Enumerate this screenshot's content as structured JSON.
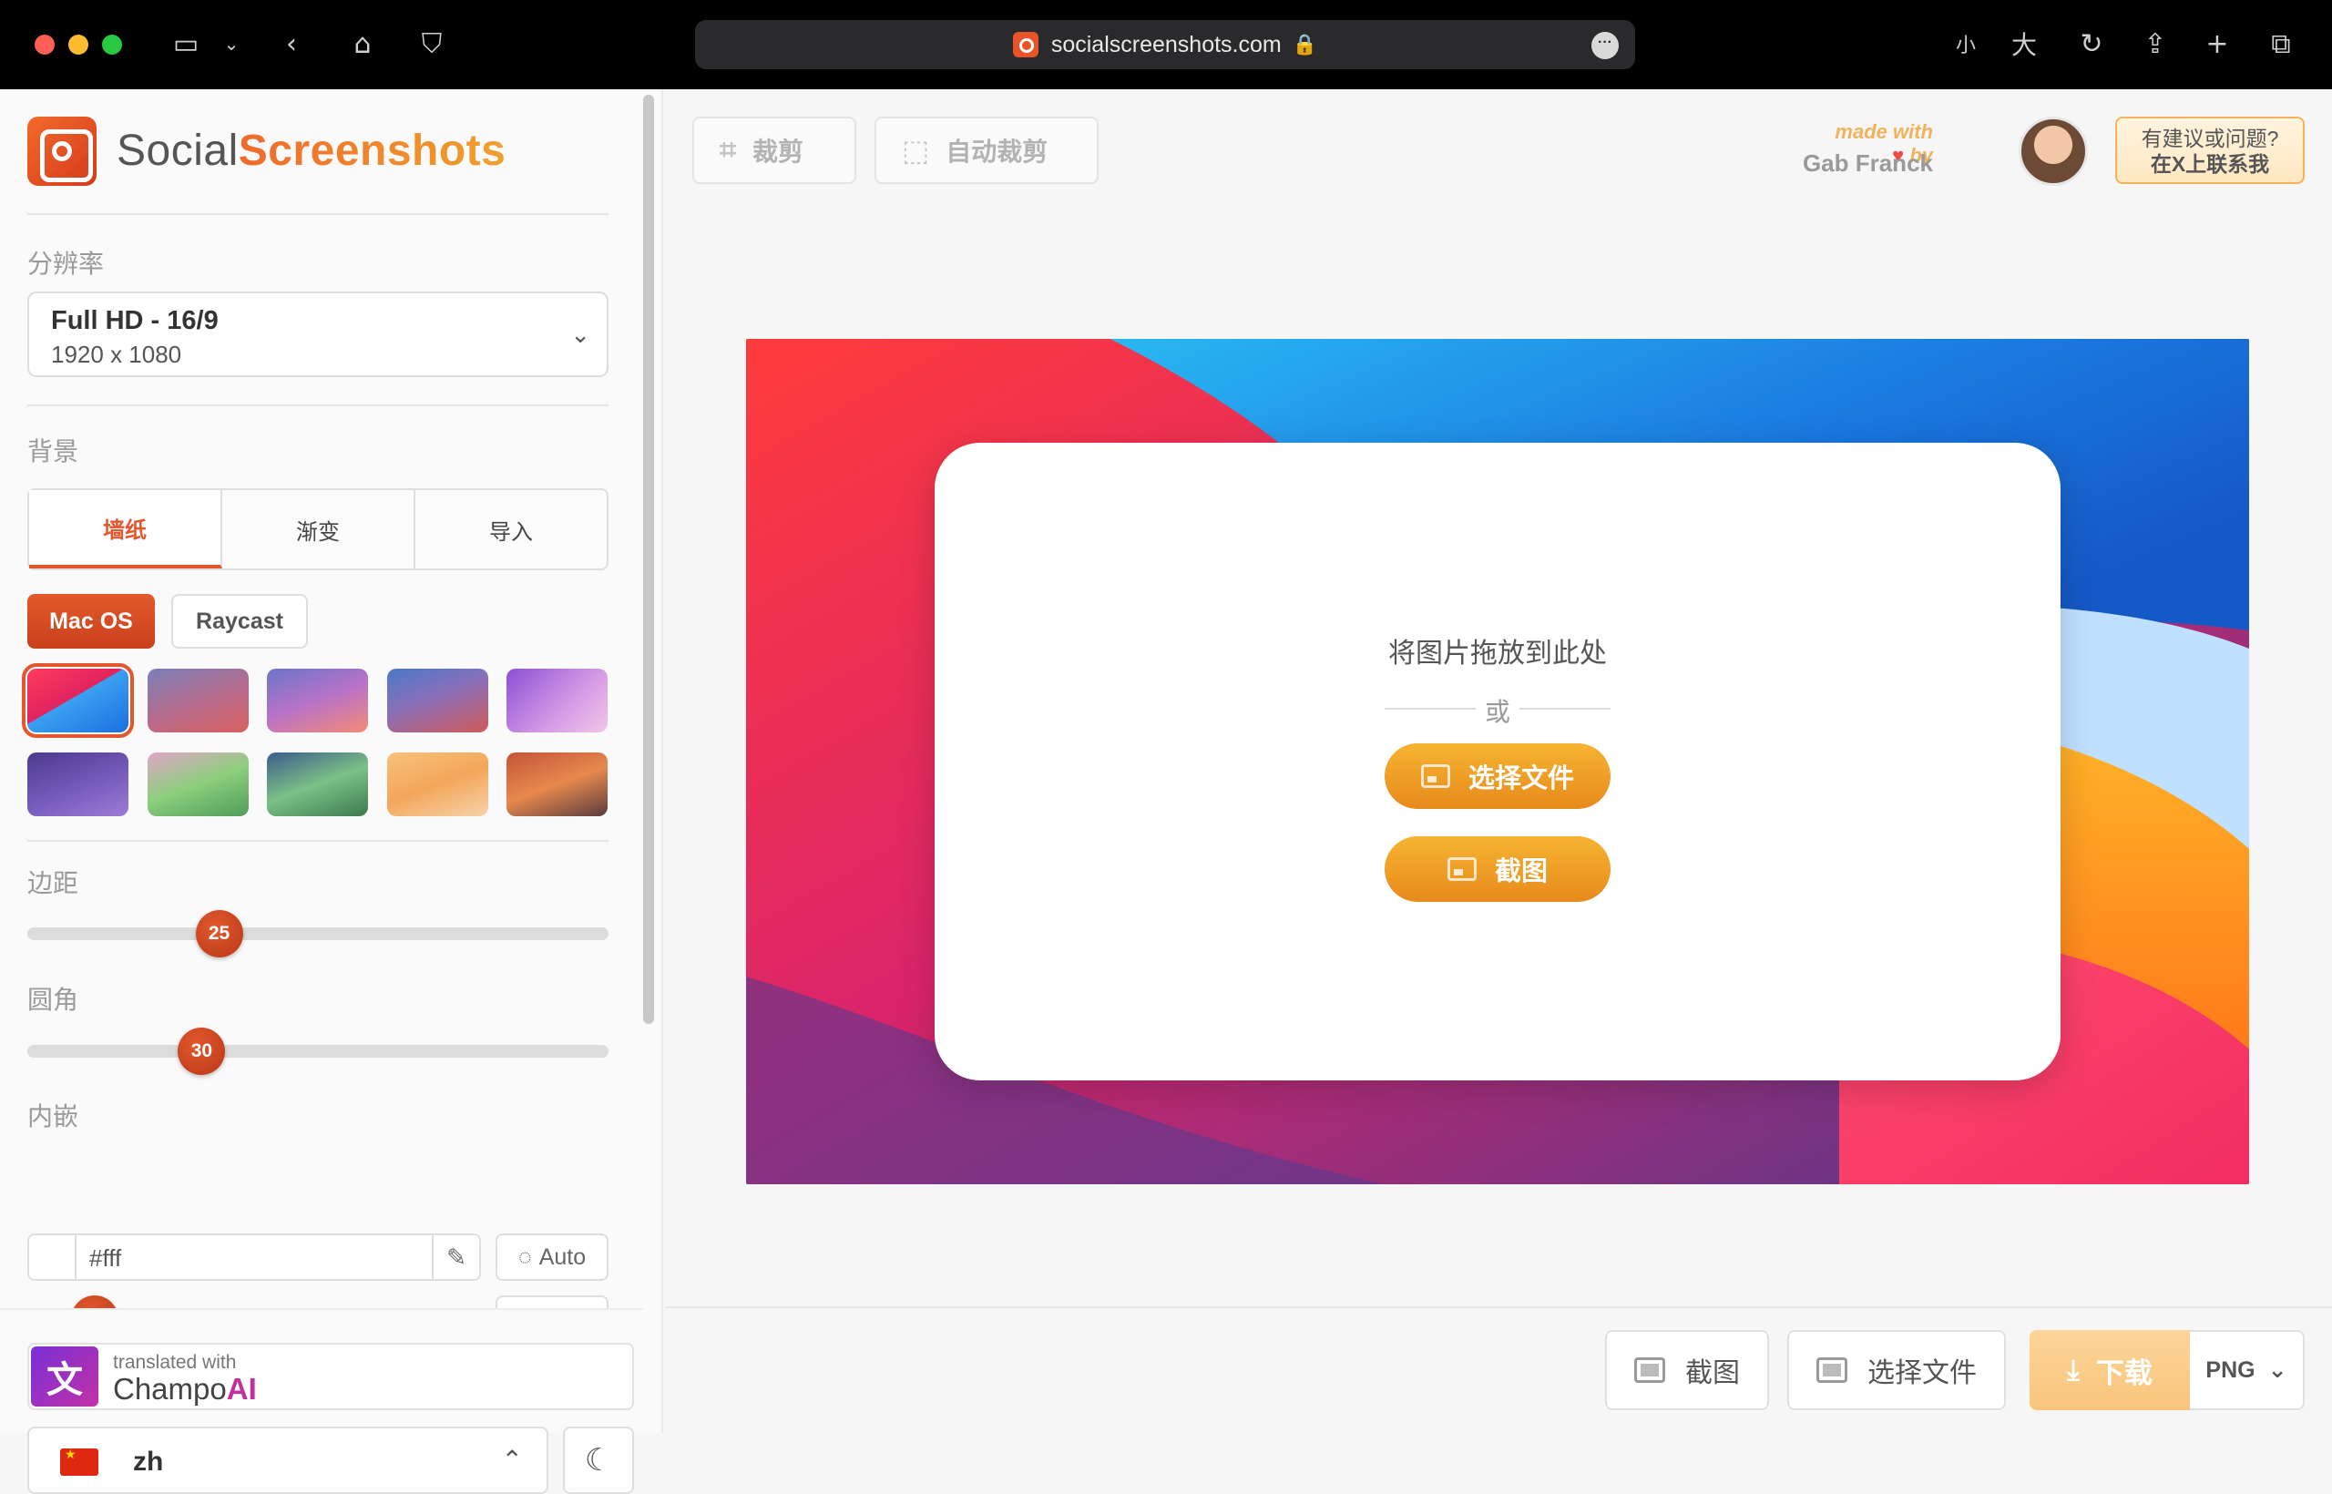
{
  "browser": {
    "url": "socialscreenshots.com",
    "text_size_small": "小",
    "text_size_large": "大"
  },
  "sidebar": {
    "brand_part1": "Social",
    "brand_part2": "Screenshots",
    "resolution": {
      "label": "分辨率",
      "selected_title": "Full HD - 16/9",
      "selected_size": "1920 x 1080"
    },
    "background": {
      "label": "背景",
      "tabs": [
        "墙纸",
        "渐变",
        "导入"
      ],
      "active_tab": "墙纸",
      "sources": [
        "Mac OS",
        "Raycast"
      ],
      "active_source": "Mac OS",
      "wallpaper_count": 10,
      "selected_wallpaper": 1
    },
    "padding": {
      "label": "边距",
      "value": "25",
      "level": 0.33
    },
    "radius": {
      "label": "圆角",
      "value": "30",
      "level": 0.3
    },
    "inset": {
      "label": "内嵌",
      "color_value": "#fff",
      "auto_label": "Auto"
    },
    "translator": {
      "small": "translated with",
      "name_part1": "Champo",
      "name_part2": "AI"
    },
    "language": {
      "code": "zh"
    }
  },
  "main": {
    "toolbar": {
      "crop_label": "裁剪",
      "autocrop_label": "自动裁剪"
    },
    "credit": {
      "made_with": "made with",
      "by": "by",
      "author": "Gab Franck"
    },
    "feedback": {
      "line1": "有建议或问题?",
      "line2": "在X上联系我"
    },
    "dropzone": {
      "drop_text": "将图片拖放到此处",
      "or_text": "或",
      "choose_file_label": "选择文件",
      "screenshot_label": "截图"
    },
    "bottom_bar": {
      "screenshot_label": "截图",
      "choose_file_label": "选择文件",
      "download_label": "下载",
      "format": "PNG"
    }
  },
  "colors": {
    "accent": "#e2572b",
    "button_orange": "#f0a12c",
    "chrome_bg": "#000000"
  }
}
